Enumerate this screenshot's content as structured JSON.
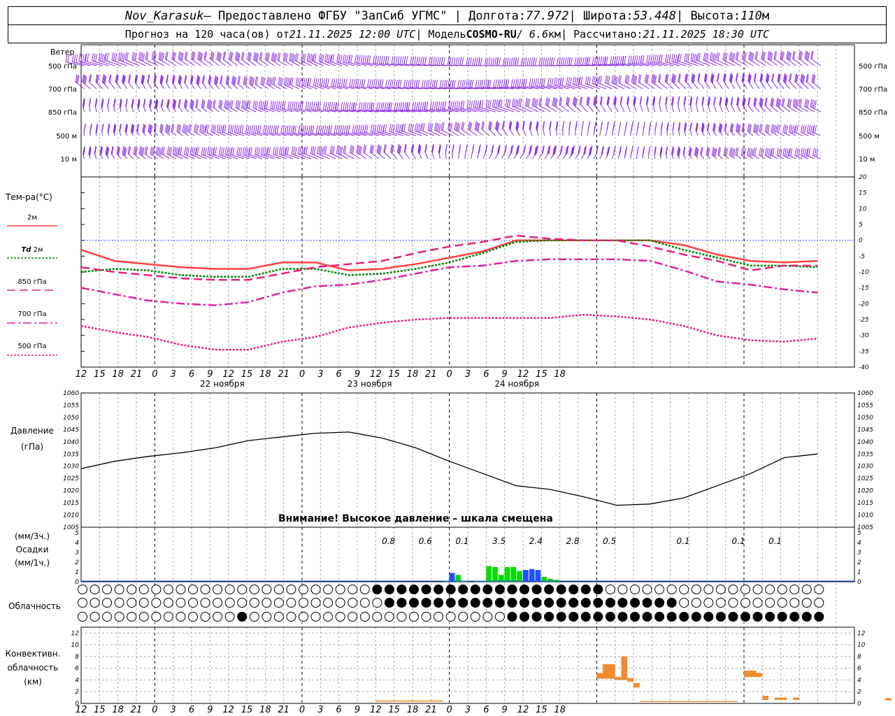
{
  "header": {
    "station": "Nov_Karasuk",
    "provider": " – Предоставлено ФГБУ \"ЗапСиб УГМС\" | Долгота: ",
    "lon": "77.972",
    "lat_label": " | Широта: ",
    "lat": "53.448",
    "alt_label": " | Высота: ",
    "alt": "110",
    "alt_unit": "м",
    "forecast_label": "Прогноз на 120 часа(ов) от ",
    "run_time": "21.11.2025 12:00 UTC",
    "model_label": " | Модель ",
    "model": "COSMO-RU",
    "res": " / 6.6",
    "res_unit": "км",
    "calc_label": " | Рассчитано: ",
    "calc_time": "21.11.2025 18:30 UTC"
  },
  "labels": {
    "wind": "Ветер",
    "temp": "Тем-ра(°C)",
    "t2m": "2м",
    "td": "Td",
    "td2m": "2м",
    "t850": "850 гПа",
    "t700": "700 гПа",
    "t500": "500 гПа",
    "pressure1": "Давление",
    "pressure2": "(гПа)",
    "precip1": "(мм/3ч.)",
    "precip2": "Осадки",
    "precip3": "(мм/1ч.)",
    "cloud": "Облачность",
    "conv1": "Конвективн.",
    "conv2": "облачность",
    "conv3": "(км)",
    "warning": "Внимание! Высокое давление – шкала смещена"
  },
  "colors": {
    "wind": "#8a2be2",
    "t2m": "#ff4040",
    "td": "#008000",
    "t850": "#e8207a",
    "t700": "#e0209a",
    "t500": "#e8208a",
    "zero": "#3050ff",
    "precip_green": "#00dd00",
    "precip_blue": "#2050ff",
    "conv": "#f08c30"
  },
  "chart_data": [
    {
      "type": "wind_barbs",
      "levels": [
        "500 гПа",
        "700 гПа",
        "850 гПа",
        "500 м",
        "10 м"
      ]
    },
    {
      "type": "line",
      "ylabel": "Тем-ра(°C)",
      "ylim": [
        -40,
        20
      ],
      "yticks": [
        20,
        15,
        10,
        5,
        0,
        -5,
        -10,
        -15,
        -20,
        -25,
        -30,
        -35,
        -40
      ],
      "x_hours": [
        0,
        6,
        12,
        18,
        24,
        30,
        36,
        42,
        48,
        54,
        60,
        66,
        72,
        78,
        84,
        90,
        96,
        102,
        108,
        114,
        120
      ],
      "series": [
        {
          "name": "2м",
          "values": [
            -3,
            -6.5,
            -7.5,
            -8.5,
            -9,
            -9,
            -7,
            -7,
            -9.5,
            -9,
            -7.5,
            -5.5,
            -3.5,
            0,
            0,
            0,
            0,
            0,
            -1.5,
            -4.5,
            -6.5,
            -7,
            -6.5
          ]
        },
        {
          "name": "Td 2м",
          "values": [
            -10,
            -9,
            -9.5,
            -11,
            -11.5,
            -11.5,
            -9,
            -9,
            -11,
            -10.5,
            -9,
            -7,
            -4,
            -0.5,
            0,
            0,
            0,
            0,
            -3,
            -5.5,
            -8,
            -8,
            -8.5
          ]
        },
        {
          "name": "850 гПа",
          "values": [
            -8.5,
            -10,
            -11,
            -12,
            -12.5,
            -12.5,
            -10.5,
            -8.5,
            -7.5,
            -6.5,
            -4,
            -2,
            -0.5,
            1.5,
            0.5,
            0,
            0,
            -2,
            -4.5,
            -6.5,
            -9.5,
            -8,
            -8
          ]
        },
        {
          "name": "700 гПа",
          "values": [
            -15,
            -17,
            -19,
            -20,
            -20.5,
            -19.5,
            -16.5,
            -14.5,
            -14,
            -12.5,
            -10.5,
            -8.5,
            -8,
            -6.5,
            -6,
            -6,
            -6,
            -6.5,
            -9.5,
            -13,
            -14,
            -15.5,
            -16.5
          ]
        },
        {
          "name": "500 гПа",
          "values": [
            -27,
            -29,
            -30.5,
            -33,
            -34.5,
            -34.5,
            -32,
            -30.5,
            -27.5,
            -26,
            -25,
            -24.5,
            -24.5,
            -24.5,
            -24.5,
            -23.5,
            -24,
            -25,
            -27,
            -30,
            -31.5,
            -32,
            -31
          ]
        }
      ]
    },
    {
      "type": "line",
      "ylabel": "Давление (гПа)",
      "ylim": [
        1005,
        1060
      ],
      "yticks": [
        1060,
        1055,
        1050,
        1045,
        1040,
        1035,
        1030,
        1025,
        1020,
        1015,
        1010,
        1005
      ],
      "series": [
        {
          "name": "Давление",
          "values": [
            1029,
            1032,
            1034,
            1035.5,
            1037.5,
            1040.5,
            1042,
            1043.5,
            1044,
            1041.5,
            1037.5,
            1032,
            1027,
            1022,
            1020.5,
            1017.5,
            1014,
            1014.5,
            1017,
            1022,
            1027,
            1033.5,
            1035
          ]
        }
      ]
    },
    {
      "type": "bar",
      "ylabel": "Осадки (мм/3ч.) (мм/1ч.)",
      "ylim": [
        0,
        5
      ],
      "yticks": [
        5,
        4,
        3,
        2,
        1,
        0
      ],
      "totals": [
        {
          "hour": "03",
          "value": "0.8"
        },
        {
          "hour": "06",
          "value": "0.6"
        },
        {
          "hour": "09",
          "value": "0.1"
        },
        {
          "hour": "12",
          "value": "3.5"
        },
        {
          "hour": "15",
          "value": "2.4"
        },
        {
          "hour": "18",
          "value": "2.8"
        },
        {
          "hour": "21",
          "value": "0.5"
        },
        {
          "hour": "03",
          "value": "0.1"
        },
        {
          "hour": "12",
          "value": "0.1"
        },
        {
          "hour": "15",
          "value": "0.1"
        }
      ],
      "hourly_hours": [
        47,
        48,
        49,
        50,
        52,
        53,
        54,
        55,
        56,
        57,
        58,
        59,
        60,
        61,
        62,
        63,
        64,
        65
      ],
      "hourly_values": [
        0.1,
        0.9,
        0.7,
        0.05,
        0.1,
        0.05,
        1.6,
        1.5,
        0.7,
        1.5,
        1.5,
        1.1,
        1.2,
        1.3,
        1.2,
        0.5,
        0.3,
        0.2
      ]
    },
    {
      "type": "bar",
      "ylabel": "Конвективн. облачность (км)",
      "ylim": [
        0,
        13
      ],
      "yticks": [
        12,
        10,
        8,
        6,
        4,
        2,
        0
      ],
      "segments": [
        {
          "h0": 36,
          "h1": 47,
          "bottom": 0.3,
          "top": 0.5
        },
        {
          "h0": 72,
          "h1": 73,
          "bottom": 4.2,
          "top": 5.2
        },
        {
          "h0": 73,
          "h1": 75,
          "bottom": 4.2,
          "top": 6.7
        },
        {
          "h0": 75,
          "h1": 76,
          "bottom": 4.0,
          "top": 4.5
        },
        {
          "h0": 76,
          "h1": 77,
          "bottom": 4.0,
          "top": 8.0
        },
        {
          "h0": 77,
          "h1": 78,
          "bottom": 3.7,
          "top": 4.3
        },
        {
          "h0": 78,
          "h1": 79,
          "bottom": 2.7,
          "top": 3.5
        },
        {
          "h0": 79,
          "h1": 95,
          "bottom": 0.25,
          "top": 0.4
        },
        {
          "h0": 96,
          "h1": 98,
          "bottom": 4.5,
          "top": 5.6
        },
        {
          "h0": 98,
          "h1": 99,
          "bottom": 4.5,
          "top": 5.2
        },
        {
          "h0": 99,
          "h1": 100,
          "bottom": 0.6,
          "top": 1.3
        },
        {
          "h0": 101,
          "h1": 103,
          "bottom": 0.6,
          "top": 1.0
        },
        {
          "h0": 104,
          "h1": 105,
          "bottom": 0.6,
          "top": 1.0
        },
        {
          "h0": 119,
          "h1": 120,
          "bottom": 0.5,
          "top": 0.9
        }
      ]
    }
  ],
  "axis": {
    "hour_labels": [
      "12",
      "15",
      "18",
      "21",
      "0",
      "3",
      "6",
      "9",
      "12",
      "15",
      "18",
      "21",
      "0",
      "3",
      "6",
      "9",
      "12",
      "15",
      "18",
      "21",
      "0",
      "3",
      "6",
      "9",
      "12",
      "15",
      "18"
    ],
    "dates": [
      "22 ноября",
      "23 ноября",
      "24 ноября"
    ],
    "date_label_hours": [
      24,
      48,
      72
    ]
  }
}
